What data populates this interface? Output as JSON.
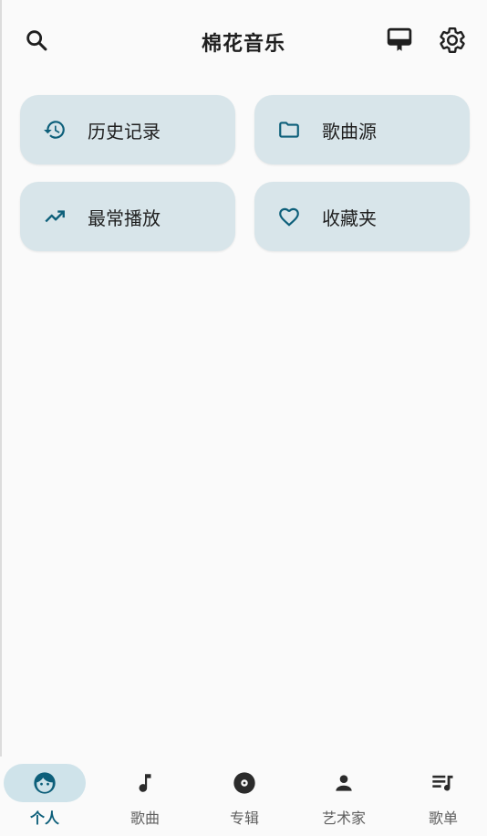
{
  "header": {
    "title": "棉花音乐"
  },
  "quick_access": [
    {
      "label": "历史记录",
      "icon": "history-icon"
    },
    {
      "label": "歌曲源",
      "icon": "folder-icon"
    },
    {
      "label": "最常播放",
      "icon": "trending-up-icon"
    },
    {
      "label": "收藏夹",
      "icon": "heart-icon"
    }
  ],
  "bottom_nav": [
    {
      "label": "个人",
      "icon": "face-icon",
      "active": true
    },
    {
      "label": "歌曲",
      "icon": "music-note-icon"
    },
    {
      "label": "专辑",
      "icon": "album-icon"
    },
    {
      "label": "艺术家",
      "icon": "person-icon"
    },
    {
      "label": "歌单",
      "icon": "playlist-icon"
    }
  ],
  "colors": {
    "accent": "#0d5f7a",
    "card_bg": "#d8e5ea",
    "active_pill": "#cfe3ea"
  }
}
